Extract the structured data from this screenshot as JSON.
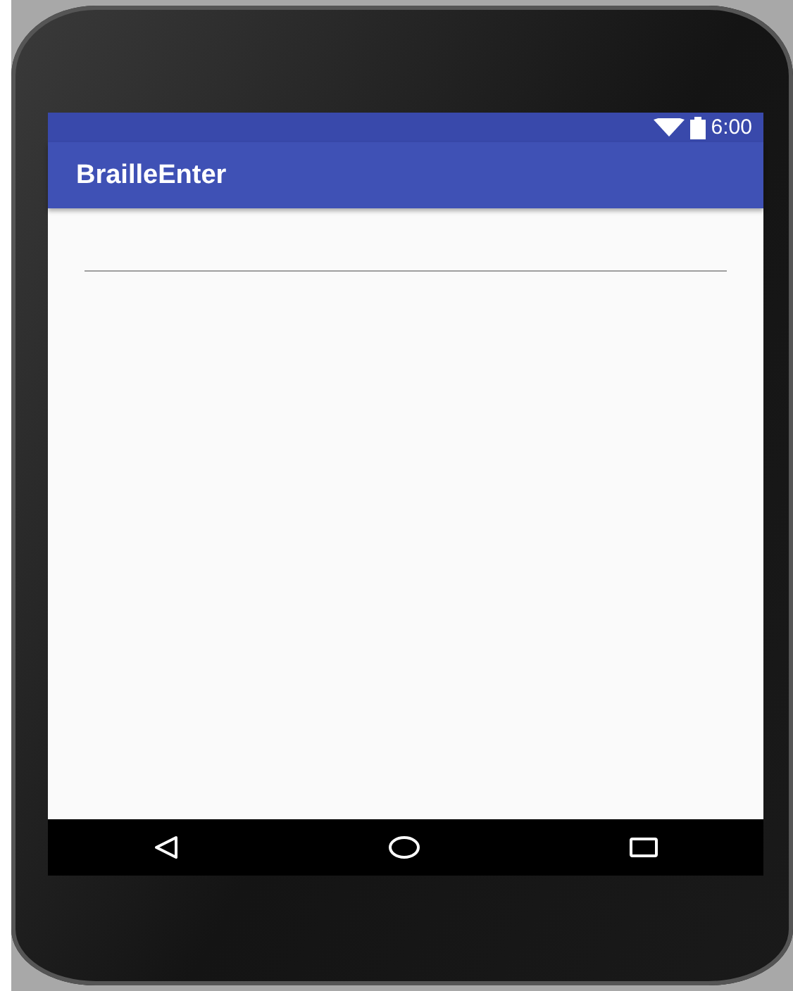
{
  "status_bar": {
    "time": "6:00"
  },
  "app_bar": {
    "title": "BrailleEnter"
  },
  "nav_bar": {
    "buttons": [
      {
        "kind": "back"
      },
      {
        "kind": "home"
      },
      {
        "kind": "recents"
      }
    ]
  }
}
